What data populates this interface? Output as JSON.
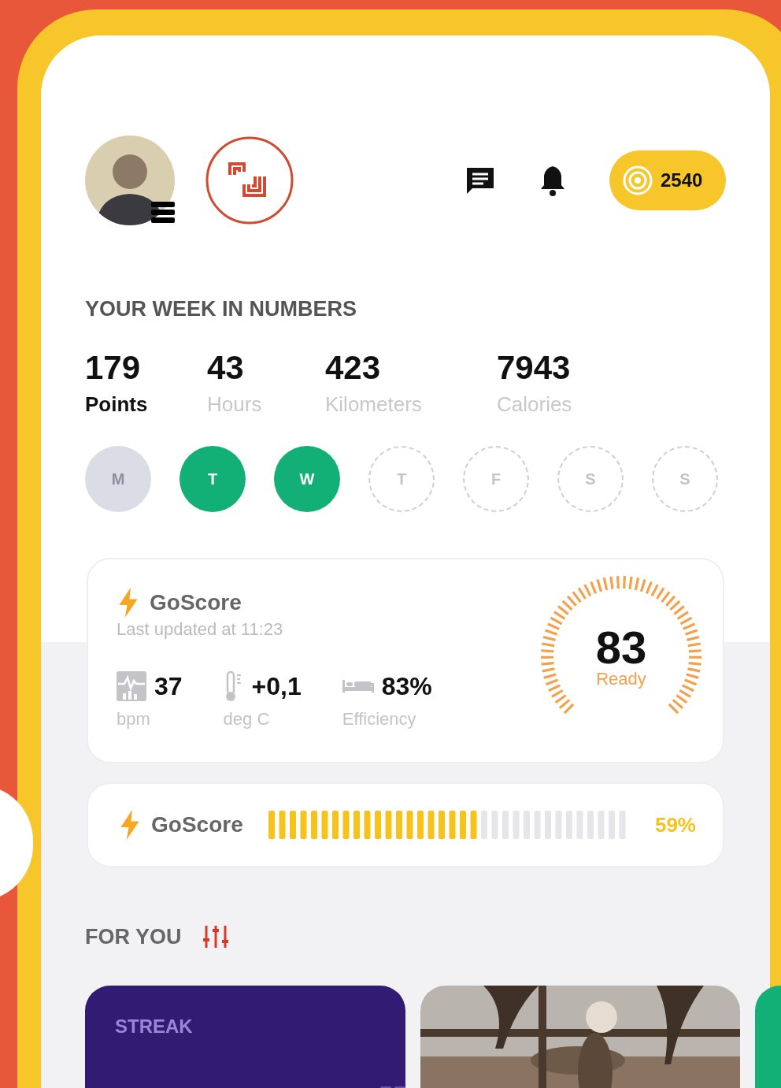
{
  "header": {
    "points_badge": "2540"
  },
  "week": {
    "title": "YOUR WEEK IN NUMBERS",
    "stats": [
      {
        "value": "179",
        "label": "Points",
        "selected": true
      },
      {
        "value": "43",
        "label": "Hours",
        "selected": false
      },
      {
        "value": "423",
        "label": "Kilometers",
        "selected": false
      },
      {
        "value": "7943",
        "label": "Calories",
        "selected": false
      }
    ],
    "days": [
      {
        "label": "M",
        "kind": "missed"
      },
      {
        "label": "T",
        "kind": "done"
      },
      {
        "label": "W",
        "kind": "done"
      },
      {
        "label": "T",
        "kind": "upcoming"
      },
      {
        "label": "F",
        "kind": "upcoming"
      },
      {
        "label": "S",
        "kind": "upcoming"
      },
      {
        "label": "S",
        "kind": "upcoming"
      }
    ]
  },
  "goscore_card": {
    "title": "GoScore",
    "updated": "Last updated at 11:23",
    "metrics": [
      {
        "kind": "heart",
        "value": "37",
        "unit": "bpm"
      },
      {
        "kind": "temperature",
        "value": "+0,1",
        "unit": "deg C"
      },
      {
        "kind": "sleep",
        "value": "83%",
        "unit": "Efficiency"
      }
    ],
    "score": "83",
    "score_label": "Ready"
  },
  "goscore_bar": {
    "title": "GoScore",
    "level": 0.59,
    "reading": "59%"
  },
  "for_you": {
    "title": "FOR YOU",
    "cards": [
      {
        "kind": "streak",
        "title": "STREAK"
      },
      {
        "kind": "picture"
      },
      {
        "kind": "green"
      }
    ]
  }
}
